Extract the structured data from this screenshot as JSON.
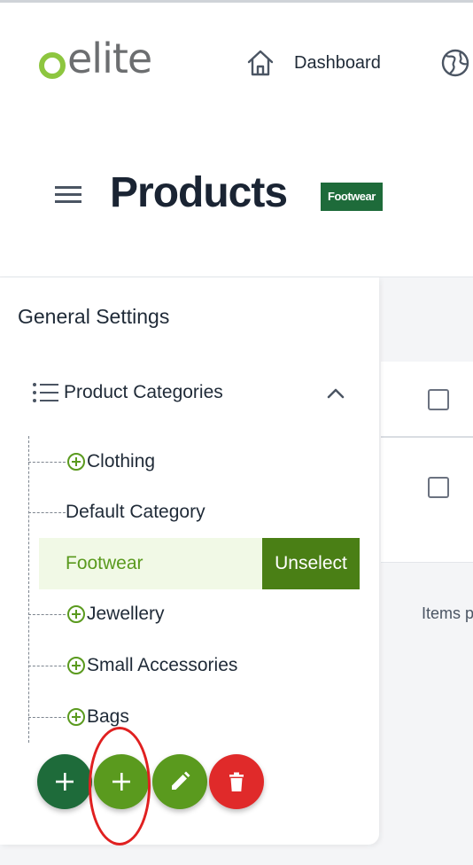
{
  "brand": {
    "logo_text": "elite",
    "logo_full": "oelite",
    "accent_color": "#8dc63f"
  },
  "nav": {
    "dashboard_label": "Dashboard",
    "dashboard_icon": "home-icon",
    "next_icon": "globe-icon"
  },
  "header": {
    "menu_icon": "hamburger-icon",
    "title": "Products",
    "badge": "Footwear"
  },
  "sidebar": {
    "section_title": "General Settings",
    "tree_header_icon": "list-icon",
    "tree_header_label": "Product Categories",
    "collapse_icon": "chevron-up-icon",
    "items": [
      {
        "label": "Clothing",
        "expandable": true
      },
      {
        "label": "Default Category",
        "expandable": false
      },
      {
        "label": "Footwear",
        "expandable": false,
        "selected": true,
        "action": "Unselect"
      },
      {
        "label": "Jewellery",
        "expandable": true
      },
      {
        "label": "Small Accessories",
        "expandable": true
      },
      {
        "label": "Bags",
        "expandable": true
      }
    ]
  },
  "fab_actions": [
    {
      "icon": "plus-icon",
      "color": "#1e6b3a"
    },
    {
      "icon": "plus-icon",
      "color": "#5a9a1e"
    },
    {
      "icon": "pencil-icon",
      "color": "#5a9a1e"
    },
    {
      "icon": "trash-icon",
      "color": "#e02a2a"
    }
  ],
  "table": {
    "footer_label": "Items p"
  },
  "colors": {
    "selected_bg": "#f1f9e6",
    "selected_text": "#5a9a1e",
    "unselect_bg": "#4a7f15",
    "badge_bg": "#1e6b3a"
  }
}
